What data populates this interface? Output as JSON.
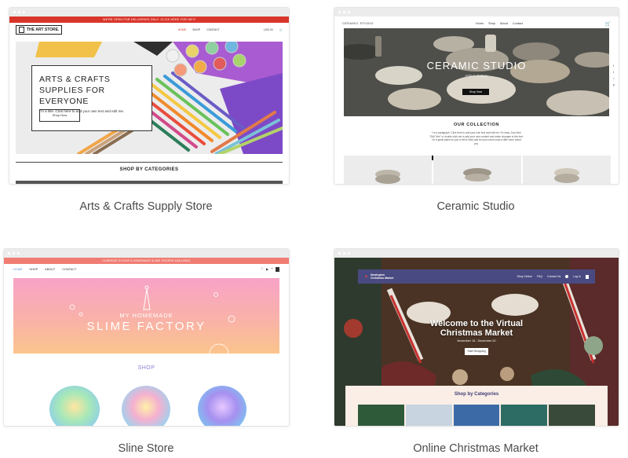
{
  "templates": [
    {
      "caption": "Arts & Crafts Supply Store",
      "banner": "WE'RE OPEN FOR DELIVERIES ONLY. CLICK HERE FOR INFO",
      "logo": "THE ART STORE.",
      "nav": [
        "HOME",
        "SHOP",
        "CONTACT"
      ],
      "nav_right": [
        "LOG IN"
      ],
      "hero_title": "ARTS & CRAFTS SUPPLIES FOR EVERYONE",
      "hero_text": "I'm a title. Click here to add your own text and edit me.",
      "hero_button": "Shop Now",
      "section_title": "SHOP BY CATEGORIES"
    },
    {
      "caption": "Ceramic Studio",
      "logo": "CERAMIC STUDIO",
      "nav": [
        "Home",
        "Shop",
        "About",
        "Contact"
      ],
      "hero_title": "CERAMIC STUDIO",
      "hero_subtitle": "Artisan Pottery",
      "hero_button": "Shop Now",
      "section_title": "OUR COLLECTION",
      "section_text": "I'm a paragraph. Click here to add your own text and edit me. It's easy. Just click \"Edit Text\" or double click me to add your own content and make changes to the font. I'm a great place for you to tell a story and let your users know a little more about you.",
      "tile_badge": "New"
    },
    {
      "caption": "Sline Store",
      "banner": "CURBSIDE PICKUP & HOMEMADE SLIME ORDERS AVAILABLE",
      "nav": [
        "HOME",
        "SHOP",
        "ABOUT",
        "CONTACT"
      ],
      "hero_pre": "MY HOMEMADE",
      "hero_title": "SLIME FACTORY",
      "section_title": "SHOP"
    },
    {
      "caption": "Online Christmas Market",
      "logo": "Newington Christmas Market",
      "nav": [
        "Shop Online",
        "FAQ",
        "Contact Us",
        "Log In"
      ],
      "hero_title": "Welcome to the Virtual Christmas Market",
      "hero_date": "November 15 - December 20",
      "hero_button": "Start Shopping",
      "section_title": "Shop by Categories"
    }
  ]
}
